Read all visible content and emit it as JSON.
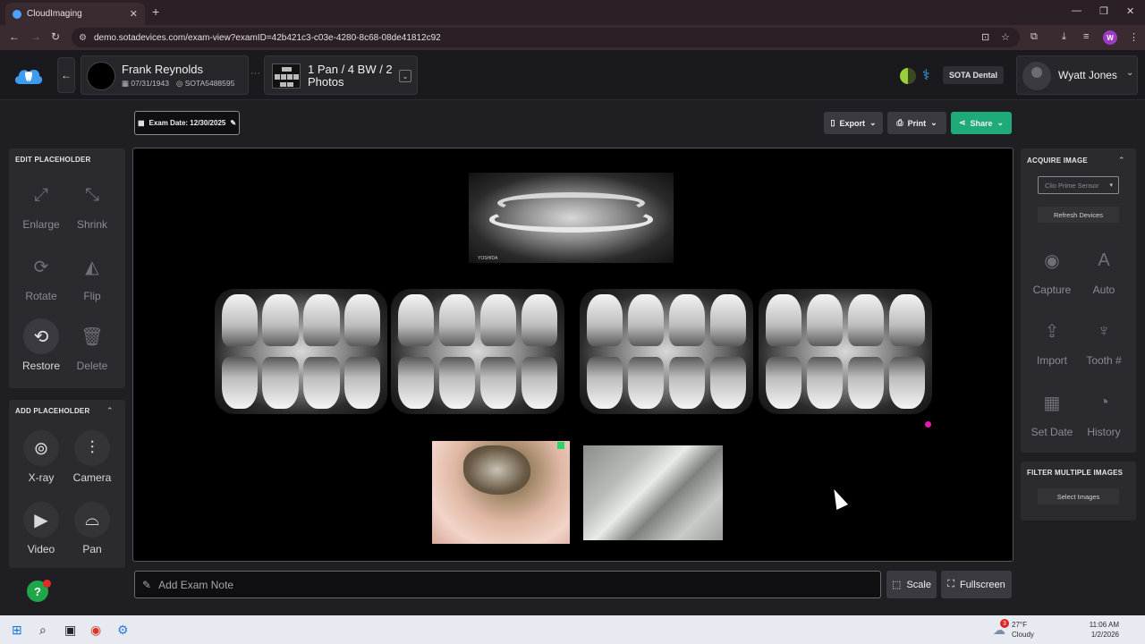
{
  "browser": {
    "tab_title": "CloudImaging",
    "url": "demo.sotadevices.com/exam-view?examID=42b421c3-c03e-4280-8c68-08de41812c92",
    "profile_initial": "W"
  },
  "header": {
    "patient": {
      "name": "Frank Reynolds",
      "dob": "07/31/1943",
      "id": "SOTA5488595"
    },
    "exam": {
      "title": "1 Pan / 4 BW / 2 Photos"
    },
    "practice": "SOTA Dental",
    "user": {
      "name": "Wyatt Jones"
    }
  },
  "toolbar": {
    "exam_date": "Exam Date: 12/30/2025",
    "export": "Export",
    "print": "Print",
    "share": "Share"
  },
  "edit_placeholder": {
    "title": "EDIT PLACEHOLDER",
    "tools": [
      {
        "label": "Enlarge",
        "icon": "enlarge-icon",
        "glyph": "⤢"
      },
      {
        "label": "Shrink",
        "icon": "shrink-icon",
        "glyph": "⤡"
      },
      {
        "label": "Rotate",
        "icon": "rotate-icon",
        "glyph": "⟳"
      },
      {
        "label": "Flip",
        "icon": "flip-icon",
        "glyph": "◭"
      },
      {
        "label": "Restore",
        "icon": "restore-icon",
        "glyph": "⟲"
      },
      {
        "label": "Delete",
        "icon": "trash-icon",
        "glyph": "🗑"
      }
    ]
  },
  "add_placeholder": {
    "title": "ADD PLACEHOLDER",
    "tools": [
      {
        "label": "X-ray",
        "icon": "xray-sensor-icon",
        "glyph": "⊚"
      },
      {
        "label": "Camera",
        "icon": "intraoral-camera-icon",
        "glyph": "⫶"
      },
      {
        "label": "Video",
        "icon": "video-icon",
        "glyph": "▶"
      },
      {
        "label": "Pan",
        "icon": "pan-icon",
        "glyph": "⌓"
      }
    ]
  },
  "acquire_image": {
    "title": "ACQUIRE IMAGE",
    "device_selected": "Clio Prime Sensor",
    "refresh": "Refresh Devices",
    "tools": [
      {
        "label": "Capture",
        "icon": "camera-icon",
        "glyph": "◉"
      },
      {
        "label": "Auto",
        "icon": "auto-icon",
        "glyph": "A"
      },
      {
        "label": "Import",
        "icon": "upload-icon",
        "glyph": "⇪"
      },
      {
        "label": "Tooth #",
        "icon": "tooth-icon",
        "glyph": "♆"
      },
      {
        "label": "Set Date",
        "icon": "calendar-icon",
        "glyph": "▦"
      },
      {
        "label": "History",
        "icon": "history-icon",
        "glyph": "◔"
      }
    ]
  },
  "filter_multiple": {
    "title": "FILTER MULTIPLE IMAGES",
    "select": "Select Images"
  },
  "bottom": {
    "note_placeholder": "Add Exam Note",
    "scale": "Scale",
    "fullscreen": "Fullscreen"
  },
  "canvas": {
    "pan_brand": "YOSHIDA"
  },
  "taskbar": {
    "weather_temp": "27°F",
    "weather_desc": "Cloudy",
    "weather_badge": "3",
    "time": "11:06 AM",
    "date": "1/2/2026"
  }
}
